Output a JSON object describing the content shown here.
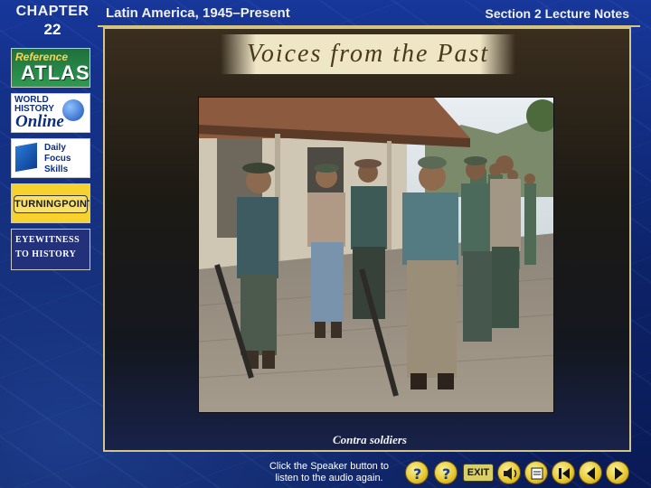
{
  "header": {
    "chapter_word": "CHAPTER",
    "chapter_number": "22",
    "chapter_title": "Latin America, 1945–Present",
    "section_title": "Section 2 Lecture Notes"
  },
  "sidebar": {
    "items": [
      {
        "label_top": "Reference",
        "label_main": "ATLAS",
        "icon": "atlas-icon"
      },
      {
        "label_top": "WORLD HISTORY",
        "label_main": "Online",
        "icon": "globe-icon"
      },
      {
        "label_top": "Daily Focus Skills",
        "icon": "cube-icon"
      },
      {
        "label_main": "TURNINGPOINT"
      },
      {
        "label_top": "EYEWITNESS",
        "label_main": "TO HISTORY"
      }
    ]
  },
  "main": {
    "banner": "Voices from the Past",
    "photo_caption": "Contra soldiers"
  },
  "footer": {
    "help_text": "Click the Speaker button to listen to the audio again.",
    "exit_label": "EXIT",
    "buttons": [
      "help-icon",
      "question-icon",
      "exit",
      "speaker-icon",
      "resource-icon",
      "first-slide-icon",
      "previous-slide-icon",
      "next-slide-icon"
    ]
  },
  "colors": {
    "background": "#0e2a78",
    "accent_gold": "#d7c37a",
    "nav_yellow": "#e8c935"
  }
}
